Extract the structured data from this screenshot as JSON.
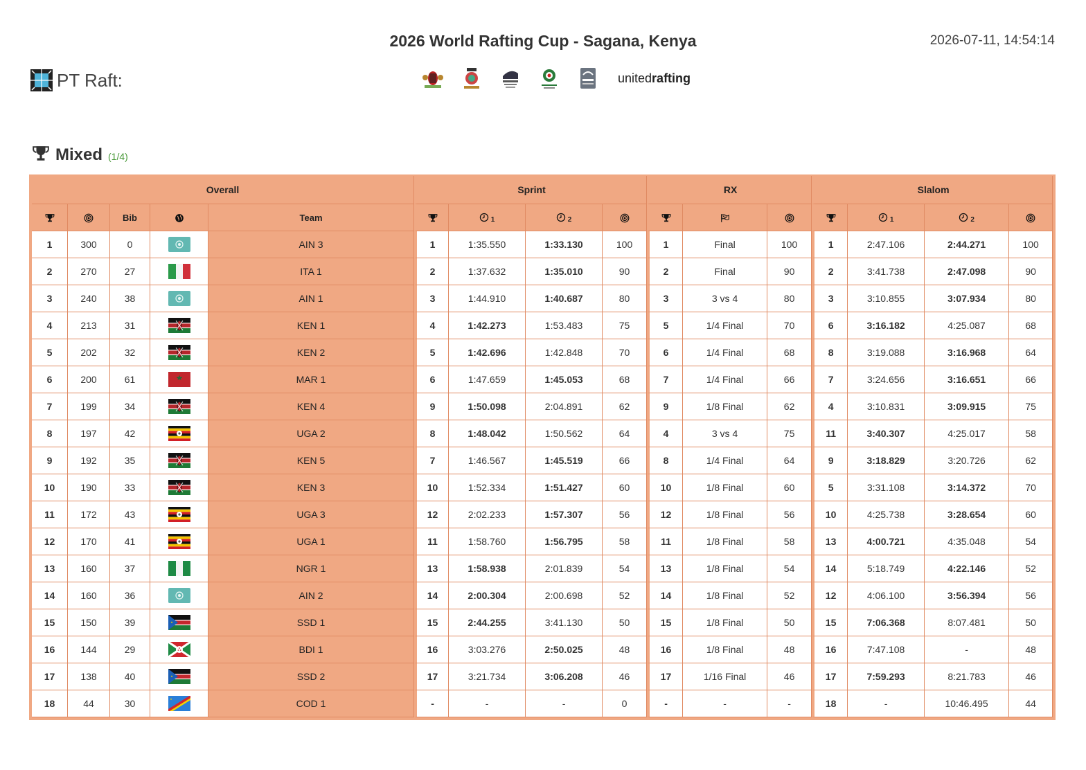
{
  "header": {
    "title": "2026 World Rafting Cup - Sagana, Kenya",
    "datetime": "2026-07-11, 14:54:14",
    "brand": "PT Raft:",
    "united_light": "united",
    "united_bold": "rafting",
    "sponsor_icons": [
      "kenya-coat-of-arms-icon",
      "county-logo-icon",
      "rafting-series-logo-icon",
      "development-fund-logo-icon",
      "rafting-federation-logo-icon"
    ]
  },
  "section": {
    "name": "Mixed",
    "count": "(1/4)"
  },
  "groups": {
    "overall": "Overall",
    "sprint": "Sprint",
    "rx": "RX",
    "slalom": "Slalom"
  },
  "columns": {
    "bib": "Bib",
    "team": "Team",
    "sub1": "1",
    "sub2": "2"
  },
  "colors": {
    "accent": "#f0a883",
    "border": "#e08a62"
  },
  "rows": [
    {
      "rank": "1",
      "pts": "300",
      "bib": "0",
      "flag": "AIN",
      "team": "AIN 3",
      "s_rank": "1",
      "s_t1": "1:35.550",
      "s_t2": "1:33.130",
      "s_best": 2,
      "s_pts": "100",
      "rx_rank": "1",
      "rx_stage": "Final",
      "rx_pts": "100",
      "sl_rank": "1",
      "sl_t1": "2:47.106",
      "sl_t2": "2:44.271",
      "sl_best": 2,
      "sl_pts": "100"
    },
    {
      "rank": "2",
      "pts": "270",
      "bib": "27",
      "flag": "ITA",
      "team": "ITA 1",
      "s_rank": "2",
      "s_t1": "1:37.632",
      "s_t2": "1:35.010",
      "s_best": 2,
      "s_pts": "90",
      "rx_rank": "2",
      "rx_stage": "Final",
      "rx_pts": "90",
      "sl_rank": "2",
      "sl_t1": "3:41.738",
      "sl_t2": "2:47.098",
      "sl_best": 2,
      "sl_pts": "90"
    },
    {
      "rank": "3",
      "pts": "240",
      "bib": "38",
      "flag": "AIN",
      "team": "AIN 1",
      "s_rank": "3",
      "s_t1": "1:44.910",
      "s_t2": "1:40.687",
      "s_best": 2,
      "s_pts": "80",
      "rx_rank": "3",
      "rx_stage": "3 vs 4",
      "rx_pts": "80",
      "sl_rank": "3",
      "sl_t1": "3:10.855",
      "sl_t2": "3:07.934",
      "sl_best": 2,
      "sl_pts": "80"
    },
    {
      "rank": "4",
      "pts": "213",
      "bib": "31",
      "flag": "KEN",
      "team": "KEN 1",
      "s_rank": "4",
      "s_t1": "1:42.273",
      "s_t2": "1:53.483",
      "s_best": 1,
      "s_pts": "75",
      "rx_rank": "5",
      "rx_stage": "1/4 Final",
      "rx_pts": "70",
      "sl_rank": "6",
      "sl_t1": "3:16.182",
      "sl_t2": "4:25.087",
      "sl_best": 1,
      "sl_pts": "68"
    },
    {
      "rank": "5",
      "pts": "202",
      "bib": "32",
      "flag": "KEN",
      "team": "KEN 2",
      "s_rank": "5",
      "s_t1": "1:42.696",
      "s_t2": "1:42.848",
      "s_best": 1,
      "s_pts": "70",
      "rx_rank": "6",
      "rx_stage": "1/4 Final",
      "rx_pts": "68",
      "sl_rank": "8",
      "sl_t1": "3:19.088",
      "sl_t2": "3:16.968",
      "sl_best": 2,
      "sl_pts": "64"
    },
    {
      "rank": "6",
      "pts": "200",
      "bib": "61",
      "flag": "MAR",
      "team": "MAR 1",
      "s_rank": "6",
      "s_t1": "1:47.659",
      "s_t2": "1:45.053",
      "s_best": 2,
      "s_pts": "68",
      "rx_rank": "7",
      "rx_stage": "1/4 Final",
      "rx_pts": "66",
      "sl_rank": "7",
      "sl_t1": "3:24.656",
      "sl_t2": "3:16.651",
      "sl_best": 2,
      "sl_pts": "66"
    },
    {
      "rank": "7",
      "pts": "199",
      "bib": "34",
      "flag": "KEN",
      "team": "KEN 4",
      "s_rank": "9",
      "s_t1": "1:50.098",
      "s_t2": "2:04.891",
      "s_best": 1,
      "s_pts": "62",
      "rx_rank": "9",
      "rx_stage": "1/8 Final",
      "rx_pts": "62",
      "sl_rank": "4",
      "sl_t1": "3:10.831",
      "sl_t2": "3:09.915",
      "sl_best": 2,
      "sl_pts": "75"
    },
    {
      "rank": "8",
      "pts": "197",
      "bib": "42",
      "flag": "UGA",
      "team": "UGA 2",
      "s_rank": "8",
      "s_t1": "1:48.042",
      "s_t2": "1:50.562",
      "s_best": 1,
      "s_pts": "64",
      "rx_rank": "4",
      "rx_stage": "3 vs 4",
      "rx_pts": "75",
      "sl_rank": "11",
      "sl_t1": "3:40.307",
      "sl_t2": "4:25.017",
      "sl_best": 1,
      "sl_pts": "58"
    },
    {
      "rank": "9",
      "pts": "192",
      "bib": "35",
      "flag": "KEN",
      "team": "KEN 5",
      "s_rank": "7",
      "s_t1": "1:46.567",
      "s_t2": "1:45.519",
      "s_best": 2,
      "s_pts": "66",
      "rx_rank": "8",
      "rx_stage": "1/4 Final",
      "rx_pts": "64",
      "sl_rank": "9",
      "sl_t1": "3:18.829",
      "sl_t2": "3:20.726",
      "sl_best": 1,
      "sl_pts": "62"
    },
    {
      "rank": "10",
      "pts": "190",
      "bib": "33",
      "flag": "KEN",
      "team": "KEN 3",
      "s_rank": "10",
      "s_t1": "1:52.334",
      "s_t2": "1:51.427",
      "s_best": 2,
      "s_pts": "60",
      "rx_rank": "10",
      "rx_stage": "1/8 Final",
      "rx_pts": "60",
      "sl_rank": "5",
      "sl_t1": "3:31.108",
      "sl_t2": "3:14.372",
      "sl_best": 2,
      "sl_pts": "70"
    },
    {
      "rank": "11",
      "pts": "172",
      "bib": "43",
      "flag": "UGA",
      "team": "UGA 3",
      "s_rank": "12",
      "s_t1": "2:02.233",
      "s_t2": "1:57.307",
      "s_best": 2,
      "s_pts": "56",
      "rx_rank": "12",
      "rx_stage": "1/8 Final",
      "rx_pts": "56",
      "sl_rank": "10",
      "sl_t1": "4:25.738",
      "sl_t2": "3:28.654",
      "sl_best": 2,
      "sl_pts": "60"
    },
    {
      "rank": "12",
      "pts": "170",
      "bib": "41",
      "flag": "UGA",
      "team": "UGA 1",
      "s_rank": "11",
      "s_t1": "1:58.760",
      "s_t2": "1:56.795",
      "s_best": 2,
      "s_pts": "58",
      "rx_rank": "11",
      "rx_stage": "1/8 Final",
      "rx_pts": "58",
      "sl_rank": "13",
      "sl_t1": "4:00.721",
      "sl_t2": "4:35.048",
      "sl_best": 1,
      "sl_pts": "54"
    },
    {
      "rank": "13",
      "pts": "160",
      "bib": "37",
      "flag": "NGR",
      "team": "NGR 1",
      "s_rank": "13",
      "s_t1": "1:58.938",
      "s_t2": "2:01.839",
      "s_best": 1,
      "s_pts": "54",
      "rx_rank": "13",
      "rx_stage": "1/8 Final",
      "rx_pts": "54",
      "sl_rank": "14",
      "sl_t1": "5:18.749",
      "sl_t2": "4:22.146",
      "sl_best": 2,
      "sl_pts": "52"
    },
    {
      "rank": "14",
      "pts": "160",
      "bib": "36",
      "flag": "AIN",
      "team": "AIN 2",
      "s_rank": "14",
      "s_t1": "2:00.304",
      "s_t2": "2:00.698",
      "s_best": 1,
      "s_pts": "52",
      "rx_rank": "14",
      "rx_stage": "1/8 Final",
      "rx_pts": "52",
      "sl_rank": "12",
      "sl_t1": "4:06.100",
      "sl_t2": "3:56.394",
      "sl_best": 2,
      "sl_pts": "56"
    },
    {
      "rank": "15",
      "pts": "150",
      "bib": "39",
      "flag": "SSD",
      "team": "SSD 1",
      "s_rank": "15",
      "s_t1": "2:44.255",
      "s_t2": "3:41.130",
      "s_best": 1,
      "s_pts": "50",
      "rx_rank": "15",
      "rx_stage": "1/8 Final",
      "rx_pts": "50",
      "sl_rank": "15",
      "sl_t1": "7:06.368",
      "sl_t2": "8:07.481",
      "sl_best": 1,
      "sl_pts": "50"
    },
    {
      "rank": "16",
      "pts": "144",
      "bib": "29",
      "flag": "BDI",
      "team": "BDI 1",
      "s_rank": "16",
      "s_t1": "3:03.276",
      "s_t2": "2:50.025",
      "s_best": 2,
      "s_pts": "48",
      "rx_rank": "16",
      "rx_stage": "1/8 Final",
      "rx_pts": "48",
      "sl_rank": "16",
      "sl_t1": "7:47.108",
      "sl_t2": "-",
      "sl_best": 0,
      "sl_pts": "48"
    },
    {
      "rank": "17",
      "pts": "138",
      "bib": "40",
      "flag": "SSD",
      "team": "SSD 2",
      "s_rank": "17",
      "s_t1": "3:21.734",
      "s_t2": "3:06.208",
      "s_best": 2,
      "s_pts": "46",
      "rx_rank": "17",
      "rx_stage": "1/16 Final",
      "rx_pts": "46",
      "sl_rank": "17",
      "sl_t1": "7:59.293",
      "sl_t2": "8:21.783",
      "sl_best": 1,
      "sl_pts": "46"
    },
    {
      "rank": "18",
      "pts": "44",
      "bib": "30",
      "flag": "COD",
      "team": "COD 1",
      "s_rank": "-",
      "s_t1": "-",
      "s_t2": "-",
      "s_best": 0,
      "s_pts": "0",
      "rx_rank": "-",
      "rx_stage": "-",
      "rx_pts": "-",
      "sl_rank": "18",
      "sl_t1": "-",
      "sl_t2": "10:46.495",
      "sl_best": 0,
      "sl_pts": "44"
    }
  ]
}
